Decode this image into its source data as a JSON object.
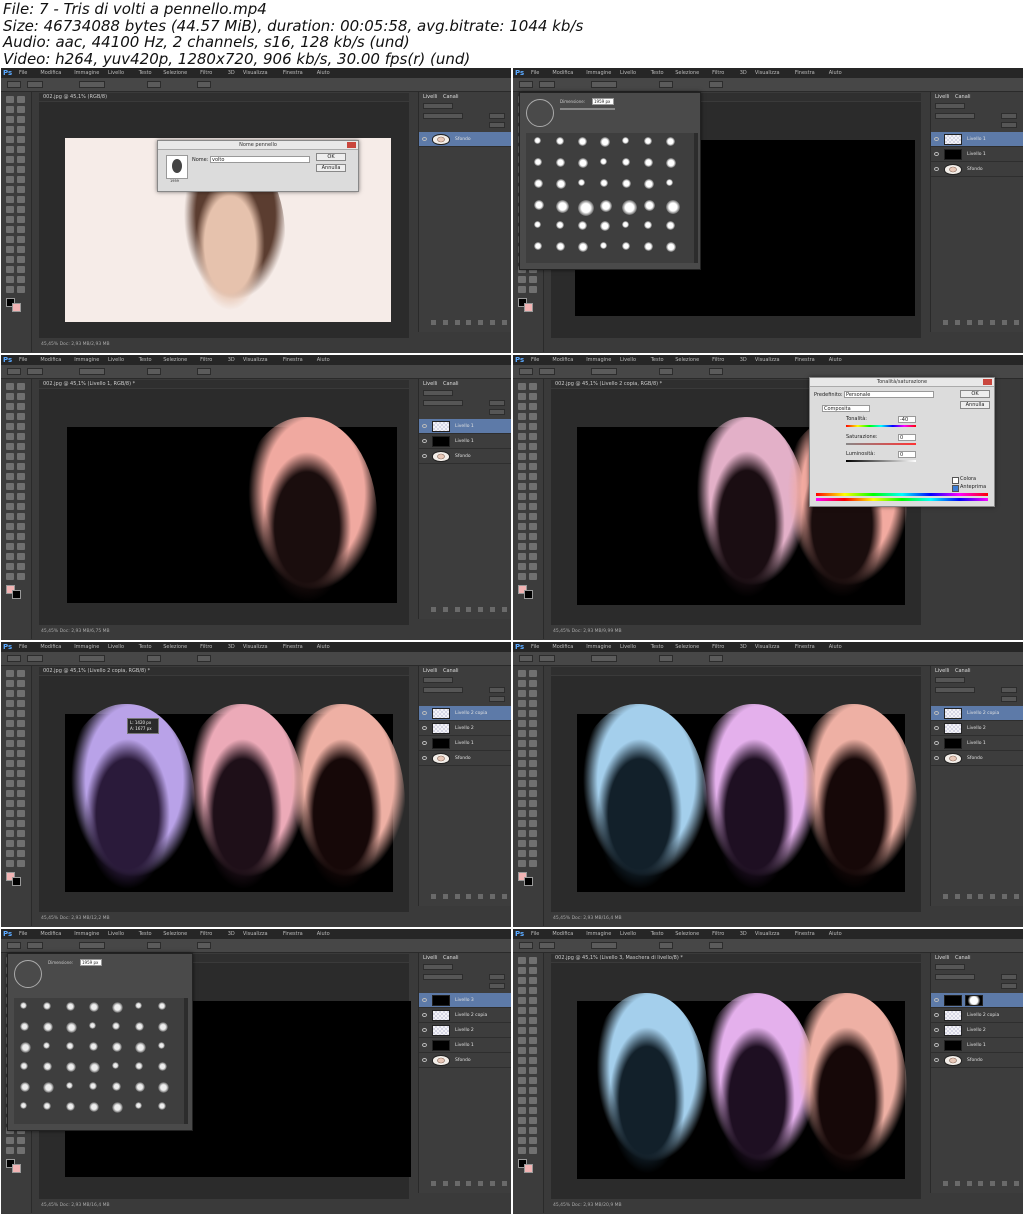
{
  "header": {
    "line1": "File: 7 - Tris di volti a pennello.mp4",
    "line2": "Size: 46734088 bytes (44.57 MiB), duration: 00:05:58, avg.bitrate: 1044 kb/s",
    "line3": "Audio: aac, 44100 Hz, 2 channels, s16, 128 kb/s (und)",
    "line4": "Video: h264, yuv420p, 1280x720, 906 kb/s, 30.00 fps(r) (und)"
  },
  "menu": [
    "File",
    "Modifica",
    "Immagine",
    "Livello",
    "Testo",
    "Selezione",
    "Filtro",
    "3D",
    "Visualizza",
    "Finestra",
    "Aiuto"
  ],
  "frames": [
    {
      "doc_title": "002.jpg @ 45,1% (RGB/8)",
      "status": "45,45%   Doc: 2,93 MB/2,93 MB",
      "layers": [
        {
          "name": "Sfondo",
          "thumb": "face",
          "sel": true
        }
      ],
      "panel_tabs": [
        "Livelli",
        "Canali"
      ]
    },
    {
      "doc_title": "",
      "status": "",
      "layers": [
        {
          "name": "Livello 1",
          "thumb": "checker",
          "sel": true
        },
        {
          "name": "Livello 1",
          "thumb": "black",
          "sel": false
        },
        {
          "name": "Sfondo",
          "thumb": "face",
          "sel": false
        }
      ],
      "panel_tabs": [
        "Livelli",
        "Canali"
      ]
    },
    {
      "doc_title": "002.jpg @ 45,1% (Livello 1, RGB/8) *",
      "status": "45,45%   Doc: 2,93 MB/6,75 MB",
      "layers": [
        {
          "name": "Livello 1",
          "thumb": "checker",
          "sel": true
        },
        {
          "name": "Livello 1",
          "thumb": "black",
          "sel": false
        },
        {
          "name": "Sfondo",
          "thumb": "face",
          "sel": false
        }
      ],
      "panel_tabs": [
        "Livelli",
        "Canali"
      ]
    },
    {
      "doc_title": "002.jpg @ 45,1% (Livello 2 copia, RGB/8) *",
      "status": "45,45%   Doc: 2,93 MB/9,99 MB",
      "layers": [],
      "panel_tabs": []
    },
    {
      "doc_title": "002.jpg @ 45,1% (Livello 2 copia, RGB/8) *",
      "status": "45,45%   Doc: 2,93 MB/12,2 MB",
      "layers": [
        {
          "name": "Livello 2 copia",
          "thumb": "checker",
          "sel": true
        },
        {
          "name": "Livello 2",
          "thumb": "checker",
          "sel": false
        },
        {
          "name": "Livello 1",
          "thumb": "black",
          "sel": false
        },
        {
          "name": "Sfondo",
          "thumb": "face",
          "sel": false
        }
      ],
      "panel_tabs": [
        "Livelli",
        "Canali"
      ]
    },
    {
      "doc_title": "",
      "status": "45,45%   Doc: 2,93 MB/16,4 MB",
      "layers": [
        {
          "name": "Livello 2 copia",
          "thumb": "checker",
          "sel": true
        },
        {
          "name": "Livello 2",
          "thumb": "checker",
          "sel": false
        },
        {
          "name": "Livello 1",
          "thumb": "black",
          "sel": false
        },
        {
          "name": "Sfondo",
          "thumb": "face",
          "sel": false
        }
      ],
      "panel_tabs": [
        "Livelli",
        "Canali"
      ]
    },
    {
      "doc_title": "",
      "status": "45,45%   Doc: 2,93 MB/16,4 MB",
      "layers": [
        {
          "name": "Livello 3",
          "thumb": "black",
          "sel": true
        },
        {
          "name": "Livello 2 copia",
          "thumb": "checker",
          "sel": false
        },
        {
          "name": "Livello 2",
          "thumb": "checker",
          "sel": false
        },
        {
          "name": "Livello 1",
          "thumb": "black",
          "sel": false
        },
        {
          "name": "Sfondo",
          "thumb": "face",
          "sel": false
        }
      ],
      "panel_tabs": [
        "Livelli",
        "Canali"
      ]
    },
    {
      "doc_title": "002.jpg @ 45,1% (Livello 3, Maschera di livello/8) *",
      "status": "45,45%   Doc: 2,93 MB/20,9 MB",
      "layers": [
        {
          "name": "",
          "thumb": "black",
          "sel": true
        },
        {
          "name": "Livello 2 copia",
          "thumb": "checker",
          "sel": false
        },
        {
          "name": "Livello 2",
          "thumb": "checker",
          "sel": false
        },
        {
          "name": "Livello 1",
          "thumb": "black",
          "sel": false
        },
        {
          "name": "Sfondo",
          "thumb": "face",
          "sel": false
        }
      ],
      "panel_tabs": [
        "Livelli",
        "Canali"
      ]
    }
  ],
  "dialog_brush_name": {
    "title": "Nome pennello",
    "label": "Nome:",
    "value": "volto",
    "ok": "OK",
    "cancel": "Annulla",
    "thumb_caption": "1959"
  },
  "dialog_hue": {
    "title": "Tonalità/saturazione",
    "preset_label": "Predefinito:",
    "preset_value": "Personale",
    "channel": "Composita",
    "hue_label": "Tonalità:",
    "hue_value": "-40",
    "sat_label": "Saturazione:",
    "sat_value": "0",
    "light_label": "Luminosità:",
    "light_value": "0",
    "colorize_label": "Colora",
    "preview_label": "Anteprima",
    "ok": "OK",
    "cancel": "Annulla"
  },
  "brush_panel": {
    "size_label": "Dimensione:",
    "size_value": "1959 px"
  },
  "tooltip": {
    "line1": "L: 1420 px",
    "line2": "A: 1677 px"
  }
}
